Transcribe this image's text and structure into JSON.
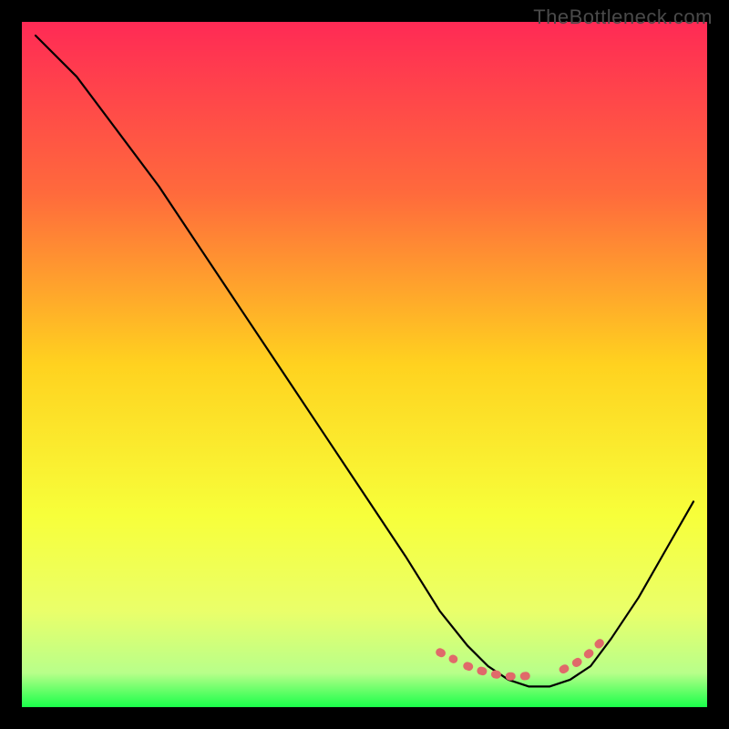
{
  "watermark": "TheBottleneck.com",
  "chart_data": {
    "type": "line",
    "title": "",
    "xlabel": "",
    "ylabel": "",
    "xlim": [
      0,
      100
    ],
    "ylim": [
      0,
      100
    ],
    "gradient_stops": [
      {
        "offset": 0,
        "color": "#ff2a55"
      },
      {
        "offset": 25,
        "color": "#ff6a3c"
      },
      {
        "offset": 50,
        "color": "#ffd21f"
      },
      {
        "offset": 72,
        "color": "#f7ff3a"
      },
      {
        "offset": 86,
        "color": "#eaff6a"
      },
      {
        "offset": 95,
        "color": "#b8ff8a"
      },
      {
        "offset": 100,
        "color": "#1aff4a"
      }
    ],
    "series": [
      {
        "name": "bottleneck-curve",
        "color": "#000000",
        "x": [
          2,
          8,
          14,
          20,
          26,
          32,
          38,
          44,
          50,
          56,
          61,
          65,
          68,
          71,
          74,
          77,
          80,
          83,
          86,
          90,
          94,
          98
        ],
        "y": [
          98,
          92,
          84,
          76,
          67,
          58,
          49,
          40,
          31,
          22,
          14,
          9,
          6,
          4,
          3,
          3,
          4,
          6,
          10,
          16,
          23,
          30
        ]
      }
    ],
    "dotted_overlay": {
      "name": "optimal-range",
      "color": "#e06a6a",
      "segments": [
        {
          "x": [
            61,
            63
          ],
          "y": [
            8,
            7
          ]
        },
        {
          "x": [
            65,
            67,
            69,
            71,
            73,
            75
          ],
          "y": [
            6,
            5.3,
            4.8,
            4.5,
            4.5,
            4.7
          ]
        },
        {
          "x": [
            79,
            81,
            83,
            85
          ],
          "y": [
            5.5,
            6.5,
            8,
            10
          ]
        }
      ]
    },
    "background_bands": [
      {
        "y_from": 0,
        "y_to": 3,
        "color": "#1aff4a"
      },
      {
        "y_from": 3,
        "y_to": 12,
        "color": "#e8ff6a"
      }
    ]
  }
}
